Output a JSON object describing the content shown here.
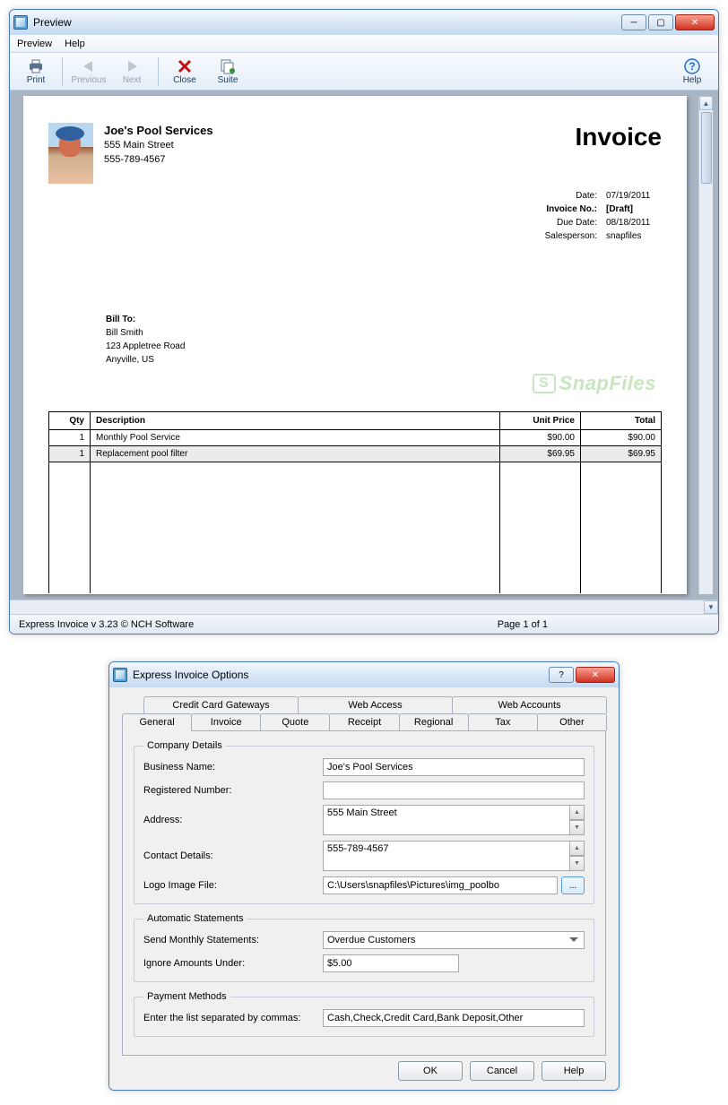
{
  "window1": {
    "title": "Preview",
    "menu": {
      "preview": "Preview",
      "help": "Help"
    },
    "toolbar": {
      "print": "Print",
      "previous": "Previous",
      "next": "Next",
      "close": "Close",
      "suite": "Suite",
      "help": "Help"
    },
    "status": {
      "left": "Express Invoice v 3.23 © NCH Software",
      "pages": "Page 1 of 1"
    }
  },
  "invoice": {
    "company": {
      "name": "Joe's Pool Services",
      "address": "555 Main Street",
      "phone": "555-789-4567"
    },
    "doc_title": "Invoice",
    "meta": {
      "date_label": "Date:",
      "date": "07/19/2011",
      "no_label": "Invoice No.:",
      "no": "[Draft]",
      "due_label": "Due Date:",
      "due": "08/18/2011",
      "sales_label": "Salesperson:",
      "sales": "snapfiles"
    },
    "bill_to": {
      "heading": "Bill To:",
      "name": "Bill Smith",
      "street": "123 Appletree Road",
      "city": "Anyville, US"
    },
    "columns": {
      "qty": "Qty",
      "desc": "Description",
      "unit": "Unit Price",
      "total": "Total"
    },
    "items": [
      {
        "qty": "1",
        "desc": "Monthly Pool Service",
        "unit": "$90.00",
        "total": "$90.00"
      },
      {
        "qty": "1",
        "desc": "Replacement pool filter",
        "unit": "$69.95",
        "total": "$69.95"
      }
    ],
    "watermark": "SnapFiles"
  },
  "window2": {
    "title": "Express Invoice Options",
    "tabs_row1": {
      "cc": "Credit Card Gateways",
      "web": "Web Access",
      "acct": "Web Accounts"
    },
    "tabs_row2": {
      "general": "General",
      "invoice": "Invoice",
      "quote": "Quote",
      "receipt": "Receipt",
      "regional": "Regional",
      "tax": "Tax",
      "other": "Other"
    },
    "company_details": {
      "legend": "Company Details",
      "business_name_label": "Business Name:",
      "business_name": "Joe's Pool Services",
      "reg_num_label": "Registered Number:",
      "reg_num": "",
      "address_label": "Address:",
      "address": "555 Main Street",
      "contact_label": "Contact Details:",
      "contact": "555-789-4567",
      "logo_label": "Logo Image File:",
      "logo": "C:\\Users\\snapfiles\\Pictures\\img_poolbo"
    },
    "auto_statements": {
      "legend": "Automatic Statements",
      "send_label": "Send Monthly Statements:",
      "send": "Overdue Customers",
      "ignore_label": "Ignore Amounts Under:",
      "ignore": "$5.00"
    },
    "payment_methods": {
      "legend": "Payment Methods",
      "label": "Enter the list separated by commas:",
      "value": "Cash,Check,Credit Card,Bank Deposit,Other"
    },
    "buttons": {
      "ok": "OK",
      "cancel": "Cancel",
      "help": "Help"
    }
  }
}
